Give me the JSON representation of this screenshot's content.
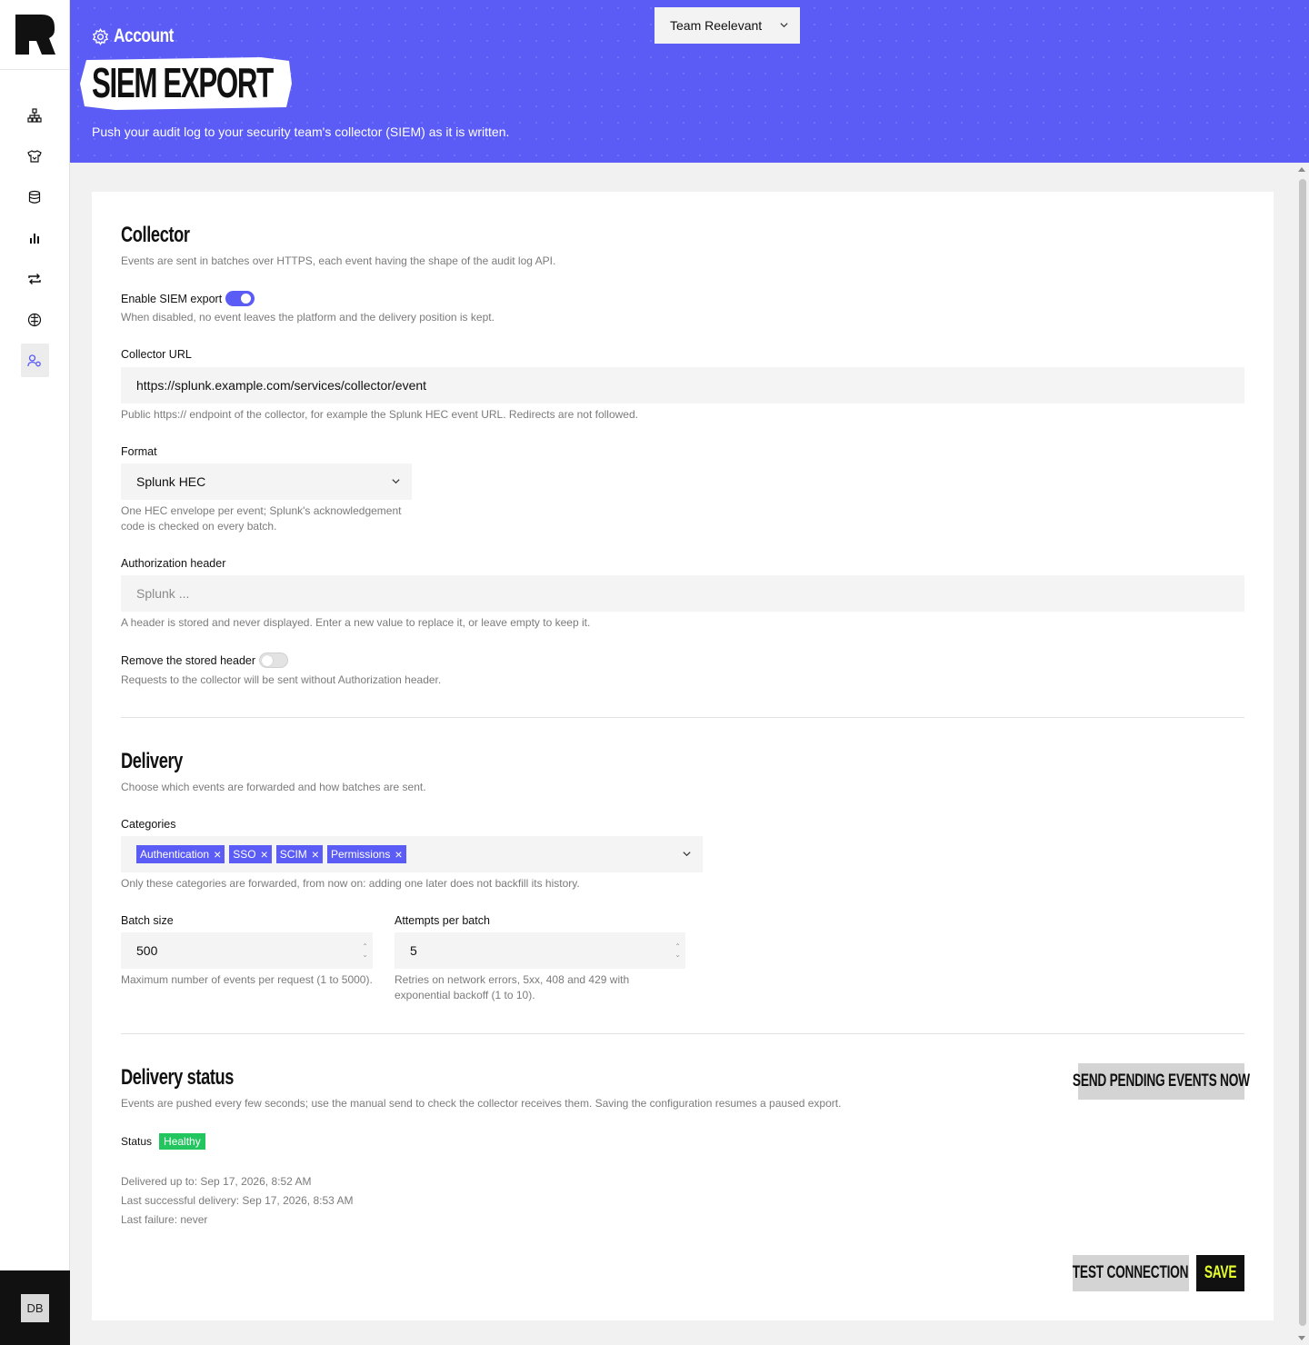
{
  "header": {
    "breadcrumb": "Account",
    "title": "SIEM EXPORT",
    "subtitle": "Push your audit log to your security team's collector (SIEM) as it is written.",
    "team_select": "Team Reelevant"
  },
  "sidebar": {
    "items": [
      {
        "icon": "hierarchy-icon"
      },
      {
        "icon": "shirt-icon"
      },
      {
        "icon": "database-icon"
      },
      {
        "icon": "bar-chart-icon"
      },
      {
        "icon": "repeat-icon"
      },
      {
        "icon": "brain-icon"
      },
      {
        "icon": "user-settings-icon",
        "active": true
      }
    ],
    "user_initials": "DB"
  },
  "collector": {
    "title": "Collector",
    "description": "Events are sent in batches over HTTPS, each event having the shape of the audit log API.",
    "enable_label": "Enable SIEM export",
    "enable_on": true,
    "enable_help": "When disabled, no event leaves the platform and the delivery position is kept.",
    "url_label": "Collector URL",
    "url_value": "https://splunk.example.com/services/collector/event",
    "url_help": "Public https:// endpoint of the collector, for example the Splunk HEC event URL. Redirects are not followed.",
    "format_label": "Format",
    "format_value": "Splunk HEC",
    "format_help_1": "One HEC envelope per event; Splunk's acknowledgement",
    "format_help_2": "code is checked on every batch.",
    "auth_label": "Authorization header",
    "auth_placeholder": "Splunk ...",
    "auth_help": "A header is stored and never displayed. Enter a new value to replace it, or leave empty to keep it.",
    "remove_label": "Remove the stored header",
    "remove_on": false,
    "remove_help": "Requests to the collector will be sent without Authorization header."
  },
  "delivery": {
    "title": "Delivery",
    "description": "Choose which events are forwarded and how batches are sent.",
    "categories_label": "Categories",
    "categories": [
      "Authentication",
      "SSO",
      "SCIM",
      "Permissions"
    ],
    "categories_help": "Only these categories are forwarded, from now on: adding one later does not backfill its history.",
    "batch_label": "Batch size",
    "batch_value": "500",
    "batch_help": "Maximum number of events per request (1 to 5000).",
    "attempts_label": "Attempts per batch",
    "attempts_value": "5",
    "attempts_help_1": "Retries on network errors, 5xx, 408 and 429 with",
    "attempts_help_2": "exponential backoff (1 to 10)."
  },
  "status": {
    "title": "Delivery status",
    "description": "Events are pushed every few seconds; use the manual send to check the collector receives them. Saving the configuration resumes a paused export.",
    "send_button": "SEND PENDING EVENTS NOW",
    "status_label": "Status",
    "status_value": "Healthy",
    "delivered_up_to": "Delivered up to: Sep 17, 2026, 8:52 AM",
    "last_success": "Last successful delivery: Sep 17, 2026, 8:53 AM",
    "last_failure": "Last failure: never"
  },
  "actions": {
    "test_label": "TEST CONNECTION",
    "save_label": "SAVE"
  },
  "colors": {
    "accent": "#5b5bf6",
    "healthy": "#22c55e",
    "save_text": "#e8ff2e"
  }
}
